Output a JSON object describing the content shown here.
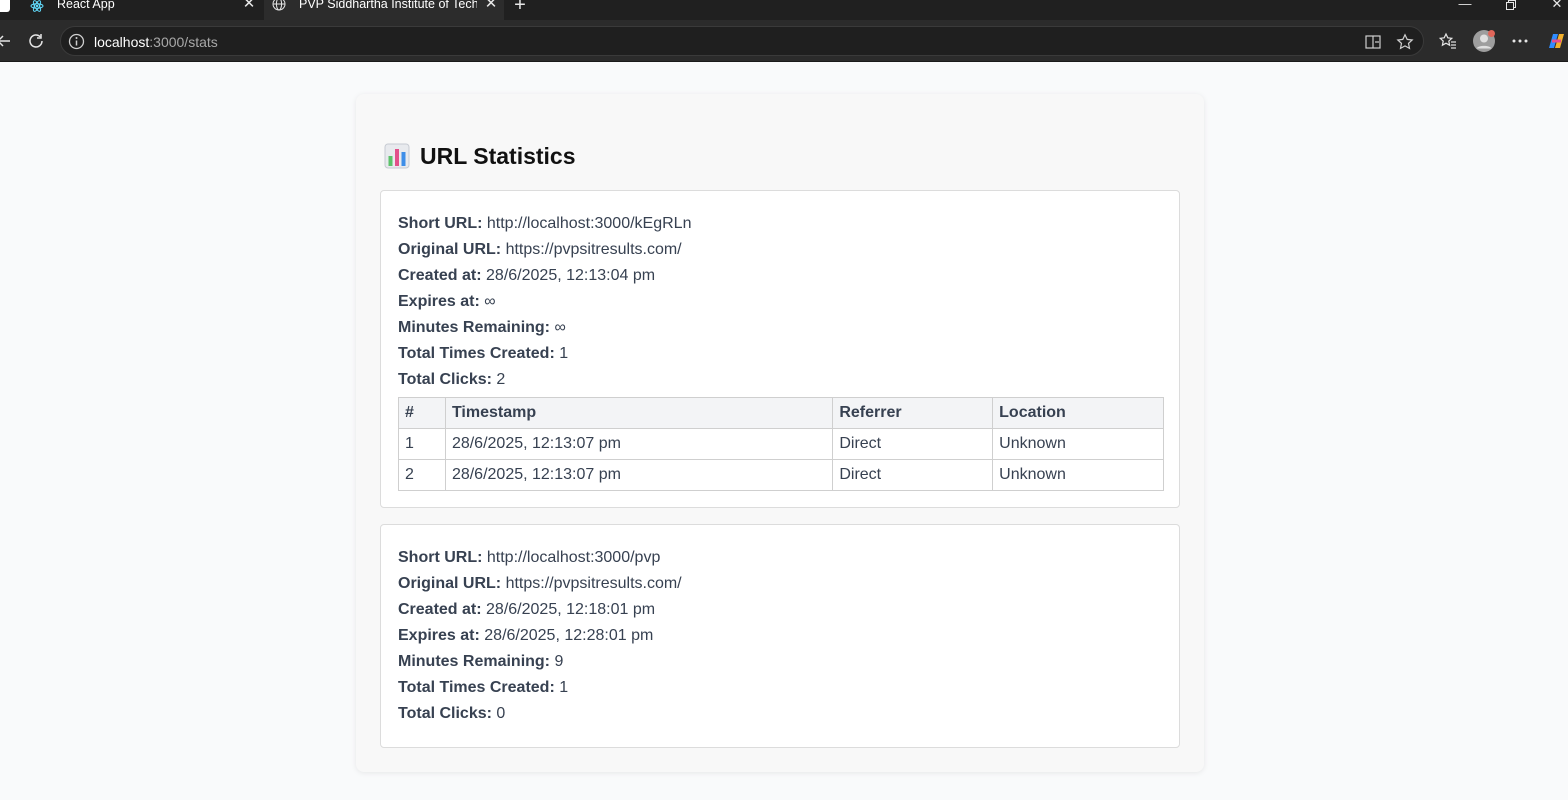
{
  "browser": {
    "tabs": [
      {
        "title": "React App",
        "icon": "react-icon"
      },
      {
        "title": "PVP Siddhartha Institute of Technology",
        "icon": "globe-icon"
      }
    ],
    "url_host": "localhost",
    "url_path": ":3000/stats"
  },
  "page": {
    "title": "URL Statistics",
    "title_icon": "bar-chart-icon"
  },
  "labels": {
    "short_url": "Short URL:",
    "original_url": "Original URL:",
    "created_at": "Created at:",
    "expires_at": "Expires at:",
    "minutes_remaining": "Minutes Remaining:",
    "total_times_created": "Total Times Created:",
    "total_clicks": "Total Clicks:"
  },
  "urls": [
    {
      "short_url": "http://localhost:3000/kEgRLn",
      "original_url": "https://pvpsitresults.com/",
      "created_at": "28/6/2025, 12:13:04 pm",
      "expires_at": "∞",
      "minutes_remaining": "∞",
      "total_times_created": "1",
      "total_clicks": "2",
      "table": {
        "headers": [
          "#",
          "Timestamp",
          "Referrer",
          "Location"
        ],
        "rows": [
          [
            "1",
            "28/6/2025, 12:13:07 pm",
            "Direct",
            "Unknown"
          ],
          [
            "2",
            "28/6/2025, 12:13:07 pm",
            "Direct",
            "Unknown"
          ]
        ]
      }
    },
    {
      "short_url": "http://localhost:3000/pvp",
      "original_url": "https://pvpsitresults.com/",
      "created_at": "28/6/2025, 12:18:01 pm",
      "expires_at": "28/6/2025, 12:28:01 pm",
      "minutes_remaining": "9",
      "total_times_created": "1",
      "total_clicks": "0"
    }
  ]
}
